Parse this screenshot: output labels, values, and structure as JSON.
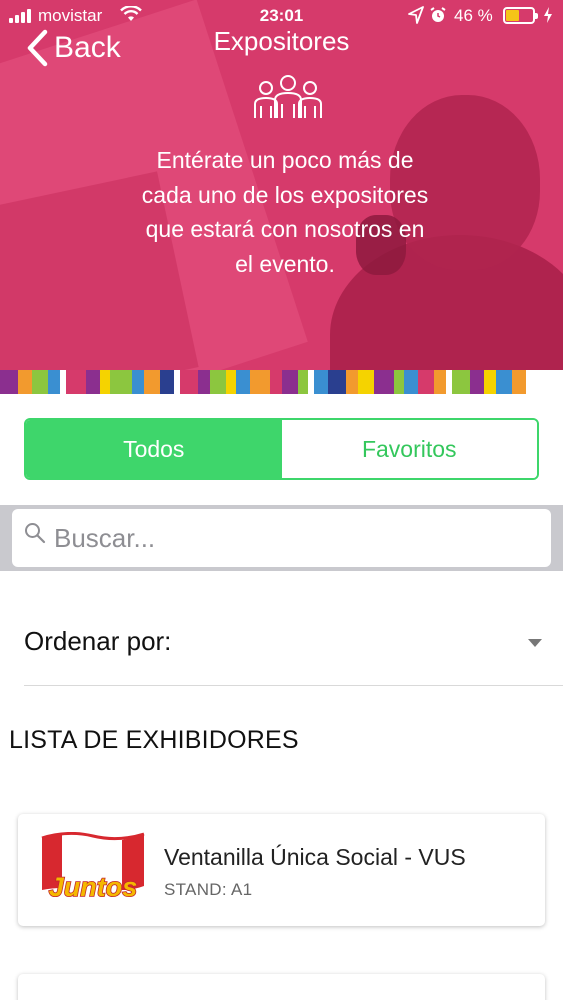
{
  "status_bar": {
    "carrier": "movistar",
    "time": "23:01",
    "battery_percent": "46 %",
    "battery_level": 0.46
  },
  "nav": {
    "back_label": "Back",
    "title": "Expositores"
  },
  "hero": {
    "description": "Entérate un poco más de cada uno de los expositores que estará con nosotros en el evento."
  },
  "filter_tabs": {
    "all_label": "Todos",
    "favorites_label": "Favoritos",
    "active": "all"
  },
  "search": {
    "placeholder": "Buscar...",
    "value": ""
  },
  "sort": {
    "label": "Ordenar por:"
  },
  "list": {
    "heading": "LISTA DE EXHIBIDORES",
    "items": [
      {
        "name": "Ventanilla Única Social - VUS",
        "stand": "STAND: A1",
        "logo_text": "Juntos"
      }
    ]
  },
  "colors": {
    "hero": "#d63a6b",
    "accent_green": "#3ed66b",
    "stripe": [
      "#8b2f8f",
      "#f29a2e",
      "#8cc63f",
      "#3a8fd1",
      "#ffffff",
      "#d63a6b",
      "#f5d300",
      "#2a3f8f"
    ]
  },
  "icons": {
    "back": "chevron-left-icon",
    "people": "people-group-icon",
    "search": "search-icon",
    "sort": "chevron-down-icon"
  }
}
